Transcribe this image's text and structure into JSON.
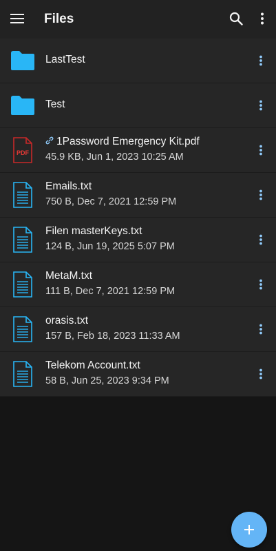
{
  "app_bar": {
    "title": "Files",
    "menu_icon": "hamburger-menu-icon",
    "search_icon": "search-icon",
    "more_icon": "more-vert-icon",
    "background": "#222222"
  },
  "colors": {
    "folder": "#29b6f6",
    "text_file": "#29b6f6",
    "pdf": "#e53935",
    "kebab": "#90caf9",
    "fab": "#64b5f6"
  },
  "items": [
    {
      "type": "folder",
      "name": "LastTest",
      "icon": "folder-icon"
    },
    {
      "type": "folder",
      "name": "Test",
      "icon": "folder-icon"
    },
    {
      "type": "pdf",
      "name": "1Password Emergency Kit.pdf",
      "meta": "45.9 KB, Jun 1, 2023 10:25 AM",
      "icon": "pdf-file-icon",
      "pdf_label": "PDF",
      "shared": true,
      "shared_icon": "link-icon"
    },
    {
      "type": "text",
      "name": "Emails.txt",
      "meta": "750 B, Dec 7, 2021 12:59 PM",
      "icon": "text-file-icon"
    },
    {
      "type": "text",
      "name": "Filen masterKeys.txt",
      "meta": "124 B, Jun 19, 2025 5:07 PM",
      "icon": "text-file-icon"
    },
    {
      "type": "text",
      "name": "MetaM.txt",
      "meta": "111 B, Dec 7, 2021 12:59 PM",
      "icon": "text-file-icon"
    },
    {
      "type": "text",
      "name": "orasis.txt",
      "meta": "157 B, Feb 18, 2023 11:33 AM",
      "icon": "text-file-icon"
    },
    {
      "type": "text",
      "name": "Telekom Account.txt",
      "meta": "58 B, Jun 25, 2023 9:34 PM",
      "icon": "text-file-icon"
    }
  ],
  "fab": {
    "icon": "plus-icon",
    "label": "+"
  }
}
